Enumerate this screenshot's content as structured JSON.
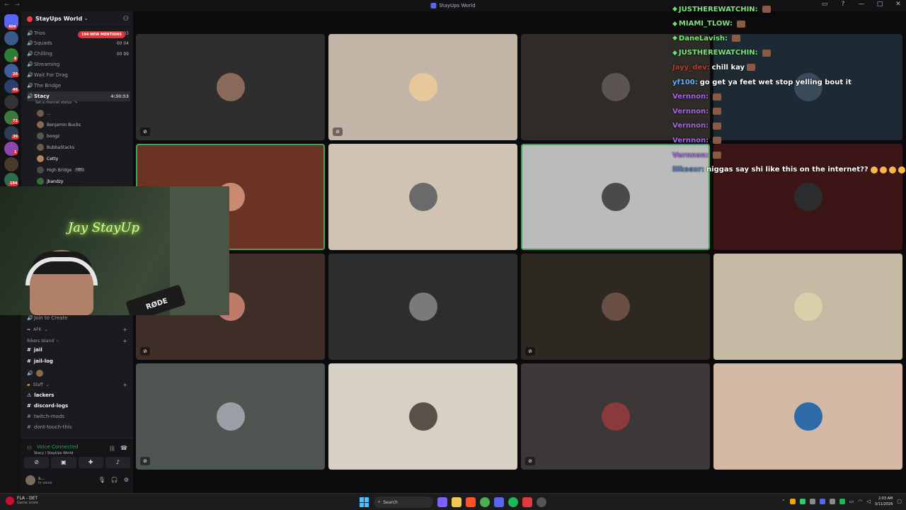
{
  "window": {
    "title": "StayUps World",
    "controls": [
      "—",
      "□",
      "✕"
    ]
  },
  "server": {
    "name": "StayUps World"
  },
  "mentions_pill": "194 NEW MENTIONS",
  "voice_channels": [
    {
      "name": "Trios",
      "right": "00  03"
    },
    {
      "name": "Squads",
      "right": "00  04"
    },
    {
      "name": "Chilling",
      "right": "00  99"
    },
    {
      "name": "Streaming",
      "right": ""
    },
    {
      "name": "Wait For Drag",
      "right": ""
    },
    {
      "name": "The Bridge",
      "right": ""
    },
    {
      "name": "Stacy",
      "right": "4:30:53"
    }
  ],
  "channel_status": "Set a channel status",
  "voice_users": [
    "...",
    "Benjamin Bucks",
    "boogz",
    "BubbaStacks",
    "Cetty",
    "High Bridge",
    "jbandzy"
  ],
  "voice_user_tag": "HBG",
  "lower_channels": {
    "join_to_create": "Join to Create",
    "afk": "AFK",
    "rikers": "Rikers Island",
    "jail": "jail",
    "jail_log": "jail-log",
    "staff": "Staff",
    "lackers": "lackers",
    "discord_logs": "discord-logs",
    "twitch_mods": "twitch-mods",
    "dont_touch": "dont-touch-this"
  },
  "voice_panel": {
    "status": "Voice Connected",
    "location": "Stacy / StayUps World",
    "user": "s...",
    "user_status": "In voice"
  },
  "rail_badges": [
    "404",
    "8",
    "20",
    "46",
    "72",
    "30",
    "1",
    "194"
  ],
  "webcam_sign": "Jay StayUp",
  "webcam_mic": "RØDE",
  "tile_colors": [
    "#2f2d2d",
    "#c3b4a8",
    "#2e2b28",
    "#1e2a33",
    "#6a3324",
    "#d1c3b3",
    "#b9bcba",
    "#3c1517",
    "#3e2e27",
    "#2c2d2c",
    "#2d2822",
    "#c7baa5",
    "#4e544f",
    "#d6d1c4",
    "#3c3838",
    "#d3b8a5"
  ],
  "chat": [
    {
      "name": "JUSTHEREWATCHIN:",
      "color": "#7fe27f",
      "text": "",
      "badge": true,
      "emote": true
    },
    {
      "name": "MIAMI_TLOW:",
      "color": "#7fe27f",
      "text": "",
      "badge": true,
      "emote": true
    },
    {
      "name": "DaneLavish:",
      "color": "#7fe27f",
      "text": "",
      "badge": true,
      "emote": true
    },
    {
      "name": "JUSTHEREWATCHIN:",
      "color": "#7fe27f",
      "text": "",
      "badge": true,
      "emote": true
    },
    {
      "name": "Jayy_dev:",
      "color": "#c0392b",
      "text": "chill kay",
      "badge": false,
      "emote": true
    },
    {
      "name": "yf100:",
      "color": "#6ab0ff",
      "text": "go get ya feet wet stop yelling bout it",
      "badge": false,
      "emote": false
    },
    {
      "name": "Vernnon:",
      "color": "#a566e8",
      "text": "",
      "badge": false,
      "emote": true
    },
    {
      "name": "Vernnon:",
      "color": "#a566e8",
      "text": "",
      "badge": false,
      "emote": true
    },
    {
      "name": "Vernnon:",
      "color": "#a566e8",
      "text": "",
      "badge": false,
      "emote": true
    },
    {
      "name": "Vernnon:",
      "color": "#a566e8",
      "text": "",
      "badge": false,
      "emote": true
    },
    {
      "name": "Vernnon:",
      "color": "#a566e8",
      "text": "",
      "badge": false,
      "emote": true
    },
    {
      "name": "lilksexr:",
      "color": "#4a78c4",
      "text": "niggas say shi like this on the internet??",
      "badge": false,
      "emote": false,
      "laughs": 4
    }
  ],
  "taskbar": {
    "game_title": "FLA - DET",
    "game_sub": "Game score",
    "search": "Search",
    "time": "2:03 AM",
    "date": "3/11/2026"
  }
}
